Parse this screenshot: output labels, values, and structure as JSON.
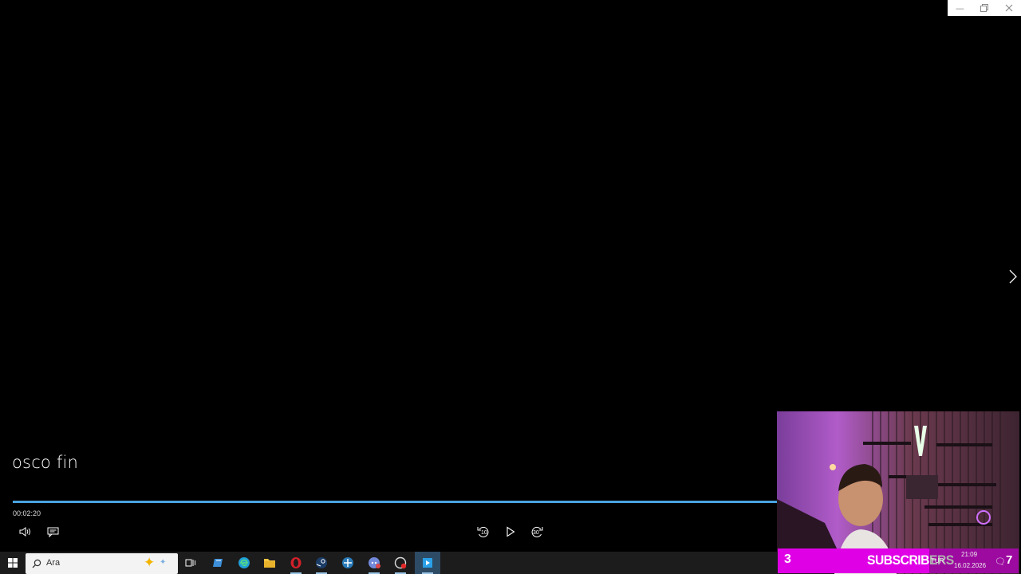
{
  "window_controls": {
    "minimize_icon": "minimize-icon",
    "restore_icon": "restore-icon",
    "close_icon": "close-icon"
  },
  "player": {
    "title": "osco fin",
    "current_time": "00:02:20",
    "progress": 1.0,
    "accent_color": "#4aa3df",
    "controls": {
      "volume_icon": "volume-icon",
      "subtitles_icon": "subtitles-icon",
      "rewind_label": "10",
      "forward_label": "30",
      "play_icon": "play-icon",
      "next_icon": "chevron-right-icon"
    }
  },
  "overlay": {
    "subscriber_count": "3",
    "subscriber_label": "SUBSCRIBERS",
    "bar_color": "#e000e6"
  },
  "taskbar": {
    "search_placeholder": "Ara",
    "apps": [
      "task-view",
      "file-transfer",
      "edge",
      "file-explorer",
      "opera",
      "steam",
      "game-launcher",
      "discord",
      "screen-recorder",
      "media-player"
    ]
  },
  "tray": {
    "language": "TUR",
    "time": "21:09",
    "date": "16.02.2026",
    "notification_count": "7"
  }
}
